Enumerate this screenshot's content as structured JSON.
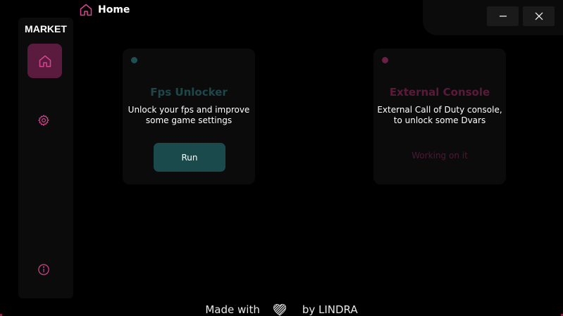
{
  "header": {
    "title": "Home",
    "icon": "home-icon"
  },
  "window_controls": {
    "minimize": "minimize-icon",
    "close": "close-icon"
  },
  "sidebar": {
    "brand": "MARKET",
    "items": [
      {
        "name": "home",
        "icon": "home-icon",
        "active": true
      },
      {
        "name": "settings",
        "icon": "gear-icon",
        "active": false
      },
      {
        "name": "info",
        "icon": "info-icon",
        "active": false
      }
    ]
  },
  "cards": [
    {
      "title": "Fps Unlocker",
      "description": "Unlock your fps and improve some game settings",
      "action_label": "Run"
    },
    {
      "title": "External Console",
      "description": "External Call of Duty console, to unlock some Dvars",
      "status": "Working on it"
    }
  ],
  "footer": {
    "prefix": "Made with",
    "icon": "heart-icon",
    "suffix": "by LINDRA"
  },
  "colors": {
    "background": "#000000",
    "panel": "#0b0b0b",
    "accent_pink": "#d4468e",
    "accent_active": "#5a1b3e",
    "teal_button": "#1b4a4c"
  }
}
